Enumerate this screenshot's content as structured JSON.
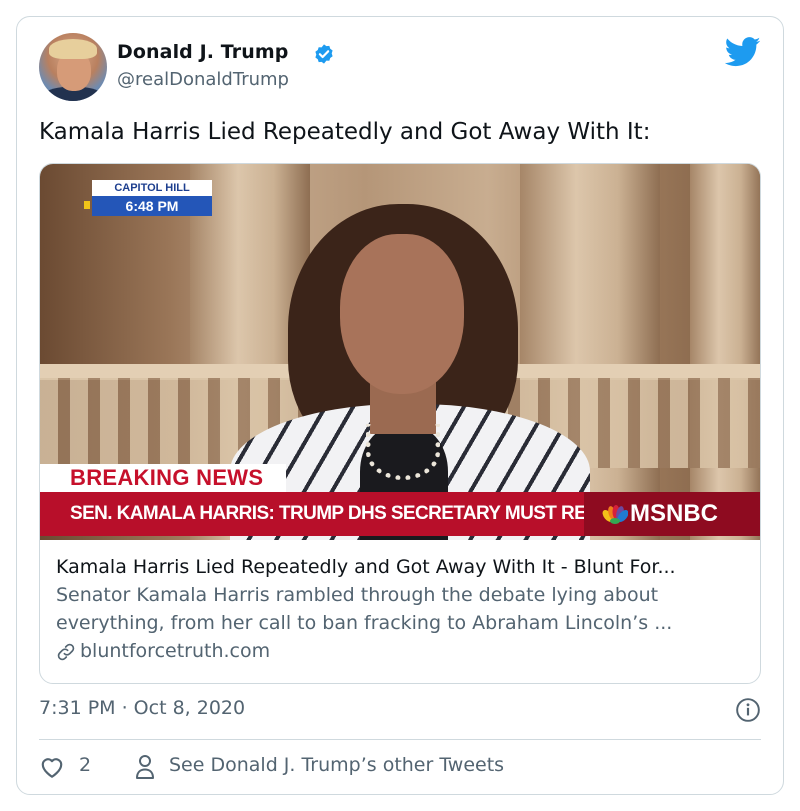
{
  "tweet": {
    "author_name": "Donald J. Trump",
    "author_handle": "@realDonaldTrump",
    "verified": true,
    "text": "Kamala Harris Lied Repeatedly and Got Away With It:",
    "timestamp": "7:31 PM · Oct 8, 2020",
    "like_count": "2",
    "other_tweets_label": "See Donald J. Trump’s other Tweets"
  },
  "link_card": {
    "title": "Kamala Harris Lied Repeatedly and Got Away With It - Blunt For...",
    "description_line_1": "Senator Kamala Harris rambled through the debate lying about",
    "description_line_2": "everything, from her call to ban fracking to Abraham Lincoln’s ...",
    "domain": "bluntforcetruth.com",
    "media": {
      "location_label": "CAPITOL HILL",
      "time_label": "6:48 PM",
      "breaking_label": "BREAKING NEWS",
      "headline": "SEN. KAMALA HARRIS: TRUMP DHS SECRETARY MUST RESIGN NOW",
      "network": "MSNBC"
    }
  },
  "icons": {
    "verified": "verified-badge-icon",
    "brand": "twitter-bird-icon",
    "link": "link-icon",
    "info": "info-icon",
    "like": "heart-icon",
    "profile": "person-icon"
  },
  "colors": {
    "brand_blue": "#1d9bf0",
    "text_primary": "#0f1419",
    "text_secondary": "#536471",
    "border": "#cfd9de",
    "breaking_red": "#b80f2a"
  }
}
